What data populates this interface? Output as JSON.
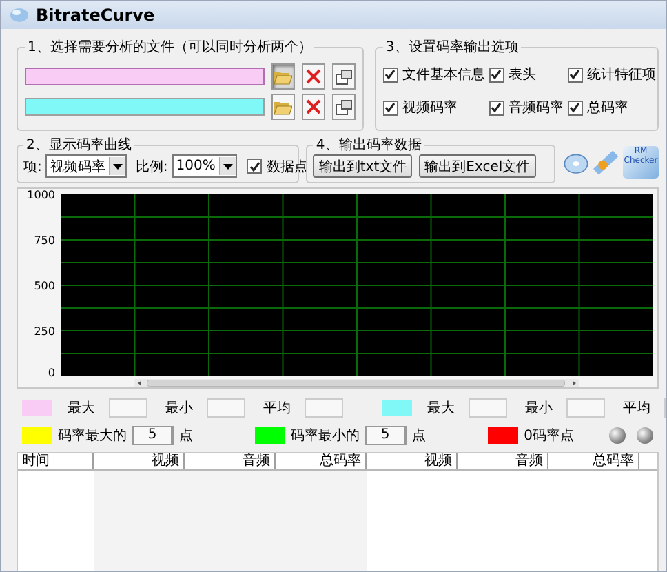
{
  "window": {
    "title": "BitrateCurve"
  },
  "file_group": {
    "title": "1、选择需要分析的文件（可以同时分析两个）",
    "files": [
      {
        "color": "#f8ccf4",
        "selected": true
      },
      {
        "color": "#80f8f8",
        "selected": false
      }
    ]
  },
  "output_options": {
    "title": "3、设置码率输出选项",
    "checkboxes": [
      {
        "label": "文件基本信息",
        "checked": true
      },
      {
        "label": "表头",
        "checked": true
      },
      {
        "label": "统计特征项",
        "checked": true
      },
      {
        "label": "视频码率",
        "checked": true
      },
      {
        "label": "音频码率",
        "checked": true
      },
      {
        "label": "总码率",
        "checked": true
      }
    ]
  },
  "curve_group": {
    "title": "2、显示码率曲线",
    "item_label": "项:",
    "item_value": "视频码率",
    "scale_label": "比例:",
    "scale_value": "100%",
    "points": {
      "label": "数据点",
      "checked": true
    }
  },
  "export_group": {
    "title": "4、输出码率数据",
    "buttons": [
      "输出到txt文件",
      "输出到Excel文件"
    ]
  },
  "tool_icons": {
    "checker_label": "RM Checker"
  },
  "chart": {
    "y_labels": [
      "1000",
      "750",
      "500",
      "250",
      "0"
    ]
  },
  "stats": [
    {
      "color": "#f8ccf4",
      "labels": [
        "最大",
        "最小",
        "平均"
      ]
    },
    {
      "color": "#80f8f8",
      "labels": [
        "最大",
        "最小",
        "平均"
      ]
    }
  ],
  "markers": [
    {
      "color": "#ffff00",
      "label": "码率最大的",
      "count": "5",
      "unit": "点"
    },
    {
      "color": "#00ff00",
      "label": "码率最小的",
      "count": "5",
      "unit": "点"
    },
    {
      "color": "#ff0000",
      "label": "0码率点"
    }
  ],
  "table": {
    "columns": [
      "时间",
      "视频",
      "音频",
      "总码率",
      "视频",
      "音频",
      "总码率"
    ]
  }
}
